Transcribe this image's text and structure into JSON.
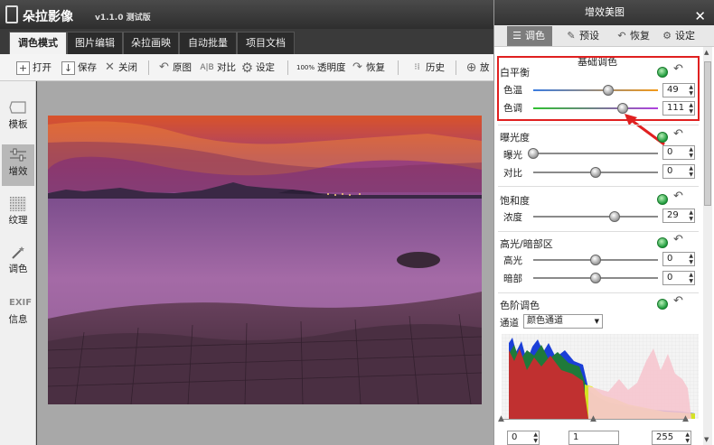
{
  "window": {
    "title": "朵拉影像",
    "version": "v1.1.0 测试版"
  },
  "tabs": [
    {
      "label": "调色模式"
    },
    {
      "label": "图片编辑"
    },
    {
      "label": "朵拉画映"
    },
    {
      "label": "自动批量"
    },
    {
      "label": "项目文档"
    }
  ],
  "toolbar": {
    "open": "打开",
    "save": "保存",
    "close": "关闭",
    "original": "原图",
    "compare": "对比",
    "settings": "设定",
    "opacity_badge": "100%",
    "opacity": "透明度",
    "restore": "恢复",
    "history": "历史",
    "zoom": "放"
  },
  "leftbar": [
    {
      "label": "模板",
      "icon": "tag-icon"
    },
    {
      "label": "增效",
      "icon": "sliders-icon"
    },
    {
      "label": "纹理",
      "icon": "texture-icon"
    },
    {
      "label": "调色",
      "icon": "magic-wand-icon"
    },
    {
      "label": "信息",
      "icon": "exif-icon",
      "icon_text": "EXIF"
    }
  ],
  "panel": {
    "title": "增效美图",
    "close": "✕",
    "tabs": [
      {
        "label": "调色",
        "icon": "sliders-icon"
      },
      {
        "label": "预设",
        "icon": "pen-icon"
      },
      {
        "label": "恢复",
        "icon": "undo-icon"
      },
      {
        "label": "设定",
        "icon": "gear-icon"
      }
    ],
    "header": "基础调色",
    "white_balance": {
      "title": "白平衡",
      "temp_label": "色温",
      "temp_value": "49",
      "temp_level": 0.6,
      "tint_label": "色调",
      "tint_value": "111",
      "tint_level": 0.72
    },
    "exposure": {
      "title": "曝光度",
      "exposure_label": "曝光",
      "exposure_value": "0",
      "exposure_level": 0.0,
      "contrast_label": "对比",
      "contrast_value": "0",
      "contrast_level": 0.5
    },
    "saturation": {
      "title": "饱和度",
      "vibrance_label": "浓度",
      "vibrance_value": "29",
      "vibrance_level": 0.65
    },
    "highlight_shadow": {
      "title": "高光/暗部区",
      "highlight_label": "高光",
      "highlight_value": "0",
      "highlight_level": 0.5,
      "shadow_label": "暗部",
      "shadow_value": "0",
      "shadow_level": 0.5
    },
    "levels": {
      "title": "色阶调色",
      "channel_label": "通道",
      "channel_value": "颜色通道",
      "input_black": "0",
      "input_gamma": "1",
      "input_white": "255"
    }
  },
  "colors": {
    "accent_red": "#e02020",
    "toggle_green": "#1d9b3b"
  }
}
